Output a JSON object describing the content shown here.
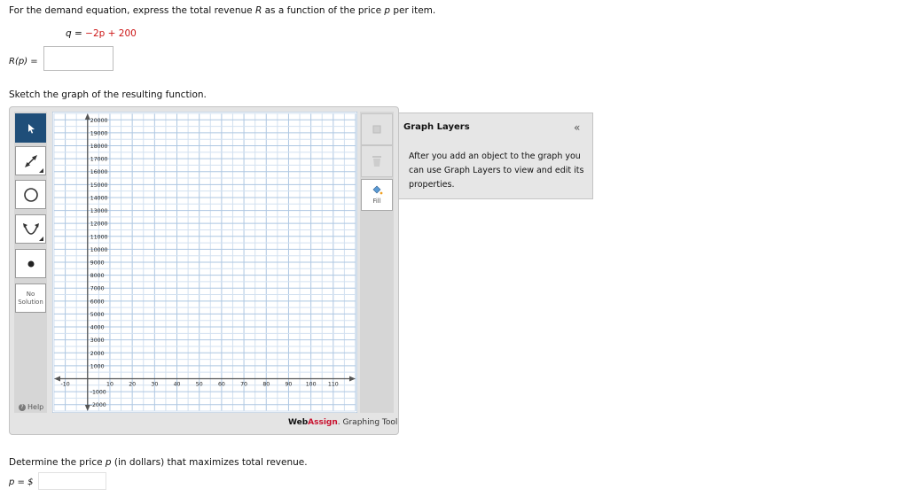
{
  "question": {
    "prompt_prefix": "For the demand equation, express the total revenue ",
    "prompt_R": "R",
    "prompt_mid": " as a function of the price ",
    "prompt_p": "p",
    "prompt_suffix": " per item.",
    "equation_left": "q = ",
    "equation_right": "−2p + 200",
    "rp_label": "R(p) =",
    "sketch_prompt": "Sketch the graph of the resulting function.",
    "determine_prefix": "Determine the price ",
    "determine_p": "p",
    "determine_suffix": " (in dollars) that maximizes total revenue.",
    "p_label": "p = $"
  },
  "tools": {
    "no_solution": "No Solution",
    "help": "Help",
    "fill": "Fill"
  },
  "graph": {
    "y_ticks": [
      "20000",
      "19000",
      "18000",
      "17000",
      "16000",
      "15000",
      "14000",
      "13000",
      "12000",
      "11000",
      "10000",
      "9000",
      "8000",
      "7000",
      "6000",
      "5000",
      "4000",
      "3000",
      "2000",
      "1000",
      "-1000",
      "-2000"
    ],
    "y_values": [
      20000,
      19000,
      18000,
      17000,
      16000,
      15000,
      14000,
      13000,
      12000,
      11000,
      10000,
      9000,
      8000,
      7000,
      6000,
      5000,
      4000,
      3000,
      2000,
      1000,
      -1000,
      -2000
    ],
    "x_ticks": [
      "-10",
      "10",
      "20",
      "30",
      "40",
      "50",
      "60",
      "70",
      "80",
      "90",
      "100",
      "110"
    ],
    "x_values": [
      -10,
      10,
      20,
      30,
      40,
      50,
      60,
      70,
      80,
      90,
      100,
      110
    ],
    "x_range": [
      -15,
      120
    ],
    "y_range": [
      -2500,
      20500
    ]
  },
  "brand": {
    "web": "Web",
    "assign": "Assign",
    "tool": ". Graphing Tool"
  },
  "layers": {
    "title": "Graph Layers",
    "collapse": "«",
    "text": "After you add an object to the graph you can use Graph Layers to view and edit its properties."
  },
  "colors": {
    "accent_red": "#cc1414",
    "grid_line": "#b8cfe6",
    "tool_selected": "#1f4e79"
  }
}
